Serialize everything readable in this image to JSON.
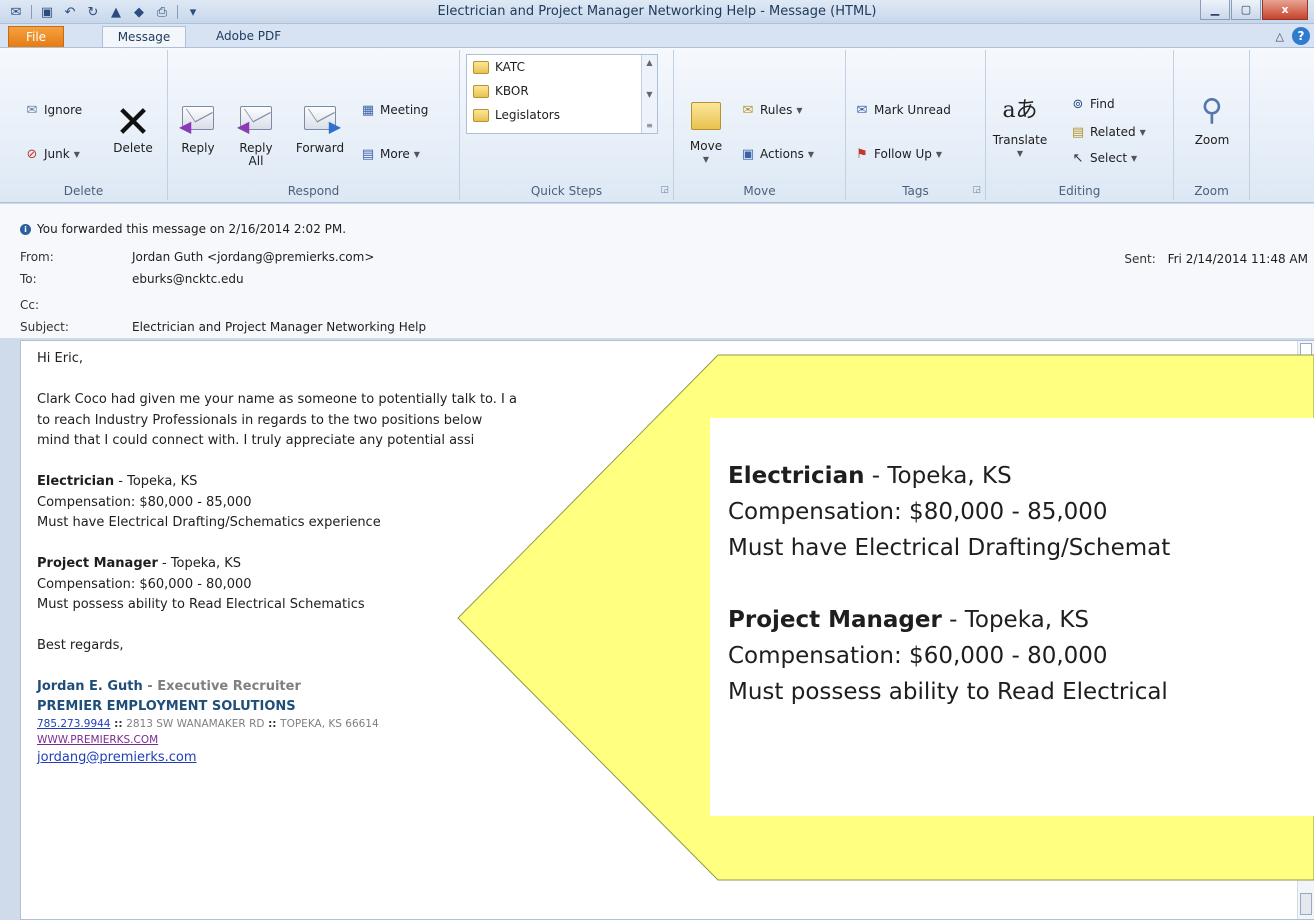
{
  "window": {
    "title": "Electrician and Project Manager Networking Help  -  Message (HTML)",
    "minimize_icon": "minimize-icon",
    "maximize_icon": "maximize-icon",
    "close_label": "x"
  },
  "tabs": [
    {
      "label": "File"
    },
    {
      "label": "Message"
    },
    {
      "label": "Adobe PDF"
    }
  ],
  "ribbon": {
    "delete_group": {
      "ignore": "Ignore",
      "junk": "Junk",
      "delete": "Delete",
      "label": "Delete"
    },
    "respond_group": {
      "reply": "Reply",
      "reply_all": "Reply All",
      "forward": "Forward",
      "meeting": "Meeting",
      "more": "More",
      "label": "Respond"
    },
    "quick_steps": {
      "items": [
        "KATC",
        "KBOR",
        "Legislators"
      ],
      "label": "Quick Steps"
    },
    "move_group": {
      "move": "Move",
      "rules": "Rules",
      "actions": "Actions",
      "label": "Move"
    },
    "tags_group": {
      "mark_unread": "Mark Unread",
      "follow_up": "Follow Up",
      "label": "Tags"
    },
    "editing_group": {
      "translate": "Translate",
      "find": "Find",
      "related": "Related",
      "select": "Select",
      "label": "Editing"
    },
    "zoom_group": {
      "zoom": "Zoom",
      "label": "Zoom"
    }
  },
  "header": {
    "info": "You forwarded this message on 2/16/2014 2:02 PM.",
    "from_label": "From:",
    "from": "Jordan Guth <jordang@premierks.com>",
    "to_label": "To:",
    "to": "eburks@ncktc.edu",
    "cc_label": "Cc:",
    "cc": "",
    "subject_label": "Subject:",
    "subject": "Electrician and Project Manager Networking Help",
    "sent_label": "Sent:",
    "sent": "Fri 2/14/2014 11:48 AM"
  },
  "body": {
    "greeting": "Hi Eric,",
    "para1_line1": "Clark Coco had given me your name as someone to potentially talk to. I a",
    "para1_line2": "to reach Industry Professionals in regards to the two positions below",
    "para1_line3": "mind that I could connect with. I truly appreciate any potential assi",
    "job1_title": "Electrician",
    "job1_location": " - Topeka, KS",
    "job1_comp": "Compensation: $80,000 - 85,000",
    "job1_req": "Must have Electrical Drafting/Schematics experience",
    "job2_title": "Project Manager",
    "job2_location": " - Topeka, KS",
    "job2_comp": "Compensation: $60,000 - 80,000",
    "job2_req": "Must possess ability to Read Electrical Schematics",
    "closing": "Best regards,",
    "sig_name": "Jordan E. Guth",
    "sig_title": " - Executive Recruiter",
    "sig_company": "PREMIER EMPLOYMENT SOLUTIONS",
    "sig_phone": "785.273.9944",
    "sig_sep": " :: ",
    "sig_address_1": "2813 SW WANAMAKER RD",
    "sig_address_2": "TOPEKA, KS 66614",
    "sig_web": "WWW.PREMIERKS.COM",
    "sig_email": "jordang@premierks.com"
  },
  "callout": {
    "fill_color": "#ffff80",
    "job1_title": "Electrician",
    "job1_location": " - Topeka, KS",
    "job1_comp": "Compensation: $80,000 - 85,000",
    "job1_req": "Must have Electrical Drafting/Schemat",
    "job2_title": "Project Manager",
    "job2_location": " - Topeka, KS",
    "job2_comp": "Compensation: $60,000 - 80,000",
    "job2_req": "Must possess ability to Read Electrical"
  },
  "colors": {
    "accent_file_tab": "#e57a10",
    "link": "#1f3fb8",
    "signature": "#1f4e79"
  }
}
